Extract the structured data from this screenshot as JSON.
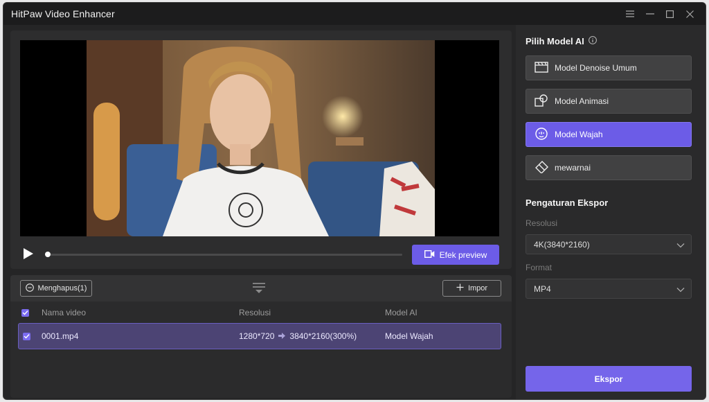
{
  "app": {
    "title": "HitPaw Video Enhancer"
  },
  "window_controls": [
    "menu-icon",
    "minimize-icon",
    "maximize-icon",
    "close-icon"
  ],
  "player": {
    "progress": 0.0,
    "preview_button": "Efek preview"
  },
  "list_toolbar": {
    "delete_button": "Menghapus(1)",
    "import_button": "Impor"
  },
  "table": {
    "headers": {
      "name": "Nama video",
      "resolution": "Resolusi",
      "model": "Model AI"
    },
    "rows": [
      {
        "name": "0001.mp4",
        "res_from": "1280*720",
        "res_to": "3840*2160(300%)",
        "model": "Model Wajah",
        "checked": true
      }
    ]
  },
  "sidebar": {
    "model_title": "Pilih Model AI",
    "models": [
      {
        "label": "Model Denoise Umum",
        "icon": "film-icon",
        "active": false
      },
      {
        "label": "Model Animasi",
        "icon": "shapes-icon",
        "active": false
      },
      {
        "label": "Model Wajah",
        "icon": "face-icon",
        "active": true
      },
      {
        "label": "mewarnai",
        "icon": "eraser-icon",
        "active": false
      }
    ],
    "export_title": "Pengaturan Ekspor",
    "resolution_label": "Resolusi",
    "resolution_value": "4K(3840*2160)",
    "format_label": "Format",
    "format_value": "MP4",
    "export_button": "Ekspor"
  },
  "colors": {
    "accent": "#6c5ce7",
    "selected_row": "#4c4474",
    "panel": "#2d2d2e"
  }
}
